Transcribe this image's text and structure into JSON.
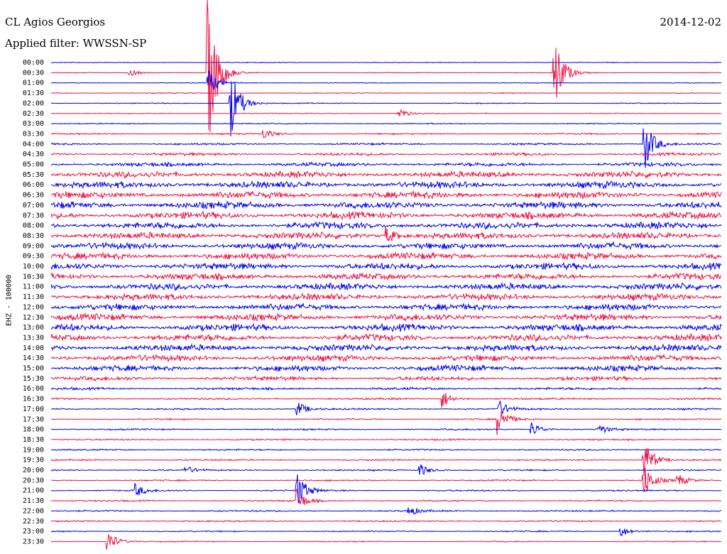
{
  "header": {
    "station": "CL Agios Georgios",
    "filter": "Applied filter: WWSSN-SP",
    "date": "2014-12-02"
  },
  "channel_label": "EHZ - 100000",
  "colors": {
    "odd_trace": "#0000ee",
    "even_trace": "#ee1144"
  },
  "chart_data": {
    "type": "line",
    "title": "CL Agios Georgios",
    "subtitle": "Applied filter: WWSSN-SP",
    "date": "2014-12-02",
    "ylabel": "EHZ - 100000",
    "xlabel": "",
    "row_labels": [
      "00:00",
      "00:30",
      "01:00",
      "01:30",
      "02:00",
      "02:30",
      "03:00",
      "03:30",
      "04:00",
      "04:30",
      "05:00",
      "05:30",
      "06:00",
      "06:30",
      "07:00",
      "07:30",
      "08:00",
      "08:30",
      "09:00",
      "09:30",
      "10:00",
      "10:30",
      "11:00",
      "11:30",
      "12:00",
      "12:30",
      "13:00",
      "13:30",
      "14:00",
      "14:30",
      "15:00",
      "15:30",
      "16:00",
      "16:30",
      "17:00",
      "17:30",
      "18:00",
      "18:30",
      "19:00",
      "19:30",
      "20:00",
      "20:30",
      "21:00",
      "21:30",
      "22:00",
      "22:30",
      "23:00",
      "23:30"
    ],
    "row_minutes": 30,
    "colors": [
      "#0000ee",
      "#ee1144"
    ],
    "noise_level": [
      0.4,
      0.4,
      0.4,
      0.5,
      0.5,
      0.5,
      0.6,
      0.8,
      1.0,
      1.5,
      2.0,
      3.2,
      3.5,
      3.6,
      3.6,
      3.6,
      3.5,
      3.5,
      3.4,
      3.4,
      3.4,
      3.4,
      3.4,
      3.4,
      3.4,
      3.5,
      3.5,
      3.5,
      3.4,
      3.3,
      3.0,
      2.2,
      1.3,
      1.0,
      0.9,
      0.8,
      0.8,
      0.8,
      0.8,
      0.8,
      0.8,
      0.8,
      0.8,
      0.8,
      0.8,
      0.8,
      0.7,
      0.6
    ],
    "events": [
      {
        "row": 1,
        "minute": 3.5,
        "amplitude": 6
      },
      {
        "row": 1,
        "minute": 7.0,
        "amplitude": 120
      },
      {
        "row": 1,
        "minute": 22.5,
        "amplitude": 60
      },
      {
        "row": 2,
        "minute": 7.0,
        "amplitude": 22
      },
      {
        "row": 4,
        "minute": 8.0,
        "amplitude": 60
      },
      {
        "row": 5,
        "minute": 15.5,
        "amplitude": 10
      },
      {
        "row": 7,
        "minute": 9.5,
        "amplitude": 8
      },
      {
        "row": 8,
        "minute": 26.5,
        "amplitude": 45
      },
      {
        "row": 17,
        "minute": 15.0,
        "amplitude": 12
      },
      {
        "row": 33,
        "minute": 17.5,
        "amplitude": 14
      },
      {
        "row": 34,
        "minute": 20.0,
        "amplitude": 14
      },
      {
        "row": 34,
        "minute": 11.0,
        "amplitude": 12
      },
      {
        "row": 35,
        "minute": 20.0,
        "amplitude": 22
      },
      {
        "row": 36,
        "minute": 21.5,
        "amplitude": 12
      },
      {
        "row": 36,
        "minute": 24.5,
        "amplitude": 8
      },
      {
        "row": 39,
        "minute": 26.5,
        "amplitude": 35
      },
      {
        "row": 40,
        "minute": 16.5,
        "amplitude": 10
      },
      {
        "row": 40,
        "minute": 6.0,
        "amplitude": 6
      },
      {
        "row": 41,
        "minute": 26.5,
        "amplitude": 28
      },
      {
        "row": 41,
        "minute": 28.0,
        "amplitude": 10
      },
      {
        "row": 42,
        "minute": 3.8,
        "amplitude": 9
      },
      {
        "row": 42,
        "minute": 11.0,
        "amplitude": 28
      },
      {
        "row": 43,
        "minute": 11.0,
        "amplitude": 16
      },
      {
        "row": 44,
        "minute": 16.0,
        "amplitude": 8
      },
      {
        "row": 46,
        "minute": 25.5,
        "amplitude": 8
      },
      {
        "row": 47,
        "minute": 2.5,
        "amplitude": 18
      }
    ]
  }
}
